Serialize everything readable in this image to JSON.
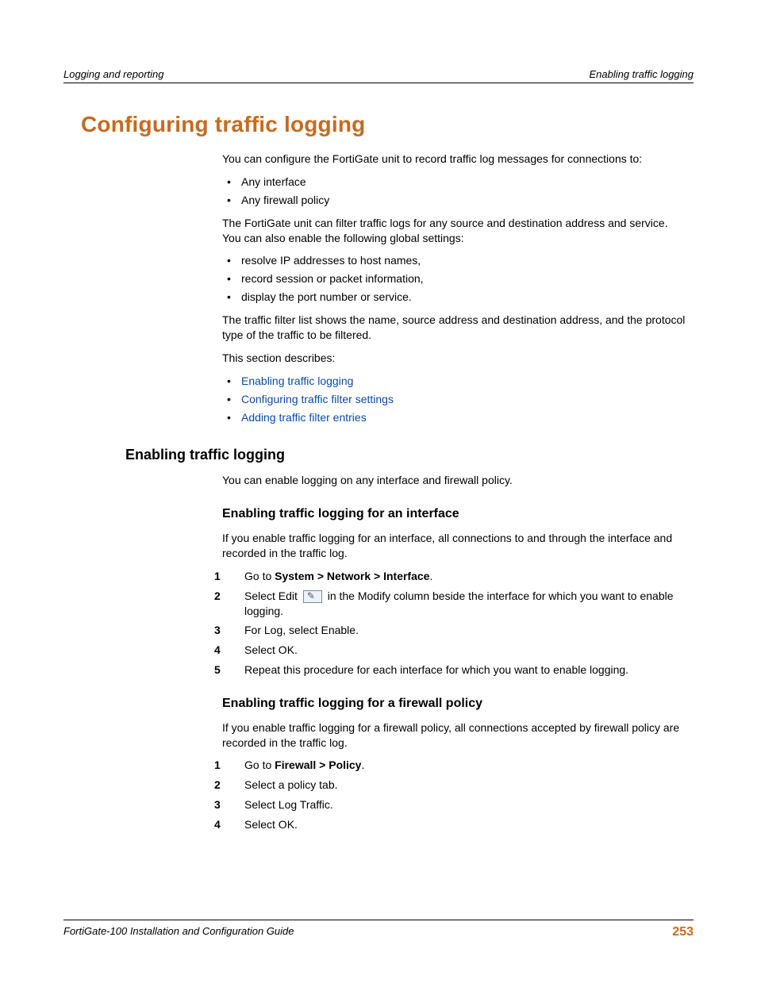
{
  "header": {
    "left": "Logging and reporting",
    "right": "Enabling traffic logging"
  },
  "title": "Configuring traffic logging",
  "intro_p1": "You can configure the FortiGate unit to record traffic log messages for connections to:",
  "intro_bullets_1": [
    "Any interface",
    "Any firewall policy"
  ],
  "intro_p2": "The FortiGate unit can filter traffic logs for any source and destination address and service. You can also enable the following global settings:",
  "intro_bullets_2": [
    "resolve IP addresses to host names,",
    "record session or packet information,",
    "display the port number or service."
  ],
  "intro_p3": "The traffic filter list shows the name, source address and destination address, and the protocol type of the traffic to be filtered.",
  "intro_p4": "This section describes:",
  "link_bullets": [
    "Enabling traffic logging",
    "Configuring traffic filter settings",
    "Adding traffic filter entries"
  ],
  "section_enabling": {
    "title": "Enabling traffic logging",
    "p1": "You can enable logging on any interface and firewall policy.",
    "iface": {
      "title": "Enabling traffic logging for an interface",
      "p1": "If you enable traffic logging for an interface, all connections to and through the interface and recorded in the traffic log.",
      "step1_pre": "Go to ",
      "step1_bold": "System > Network > Interface",
      "step1_post": ".",
      "step2_pre": "Select Edit ",
      "step2_post": " in the Modify column beside the interface for which you want to enable logging.",
      "step3": "For Log, select Enable.",
      "step4": "Select OK.",
      "step5": "Repeat this procedure for each interface for which you want to enable logging."
    },
    "policy": {
      "title": "Enabling traffic logging for a firewall policy",
      "p1": "If you enable traffic logging for a firewall policy, all connections accepted by firewall policy are recorded in the traffic log.",
      "step1_pre": "Go to ",
      "step1_bold": "Firewall > Policy",
      "step1_post": ".",
      "step2": "Select a policy tab.",
      "step3": "Select Log Traffic.",
      "step4": "Select OK."
    }
  },
  "footer": {
    "left": "FortiGate-100 Installation and Configuration Guide",
    "page": "253"
  },
  "nums": {
    "n1": "1",
    "n2": "2",
    "n3": "3",
    "n4": "4",
    "n5": "5"
  }
}
